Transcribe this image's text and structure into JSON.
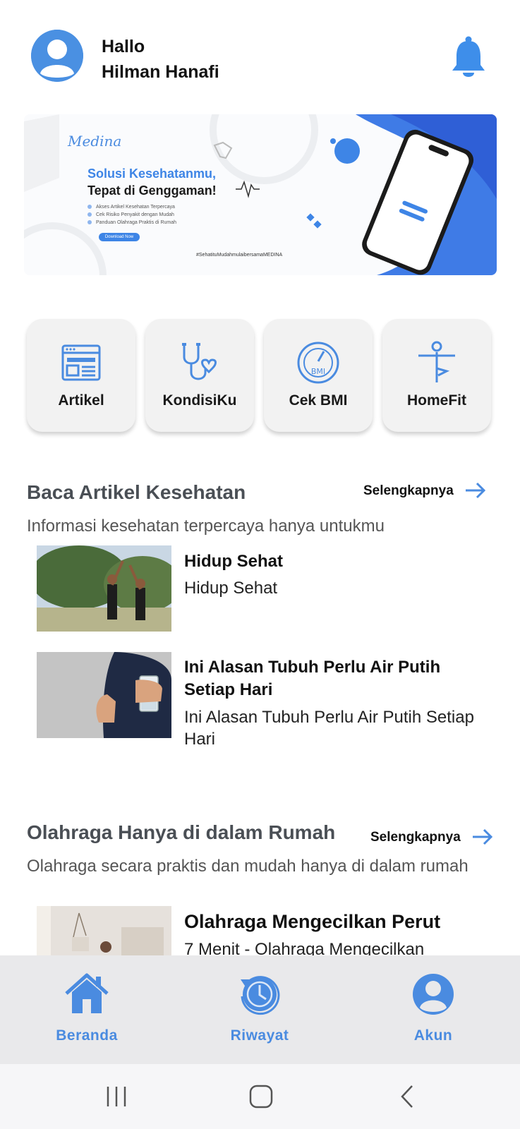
{
  "header": {
    "greeting": "Hallo",
    "user_name": "Hilman Hanafi",
    "avatar_icon": "user-avatar-icon",
    "notification_icon": "bell-icon"
  },
  "banner": {
    "logo_text": "Medina",
    "headline_1": "Solusi Kesehatanmu,",
    "headline_2": "Tepat di Genggaman!",
    "bullets": [
      "Akses Artikel Kesehatan Terpercaya",
      "Cek Risiko Penyakit dengan Mudah",
      "Panduan Olahraga Praktis di Rumah"
    ],
    "button_label": "Download Now",
    "hashtag": "#SehatituMudahmulaibersamaMEDINA"
  },
  "features": [
    {
      "label": "Artikel",
      "icon": "article-icon"
    },
    {
      "label": "KondisiKu",
      "icon": "stethoscope-heart-icon"
    },
    {
      "label": "Cek BMI",
      "icon": "bmi-gauge-icon"
    },
    {
      "label": "HomeFit",
      "icon": "exercise-person-icon"
    }
  ],
  "articles_section": {
    "title": "Baca Artikel Kesehatan",
    "more_label": "Selengkapnya",
    "subtitle": "Informasi kesehatan terpercaya hanya untukmu",
    "items": [
      {
        "title": "Hidup Sehat",
        "subtitle": "Hidup Sehat"
      },
      {
        "title": "Ini Alasan Tubuh Perlu Air Putih Setiap Hari",
        "subtitle": "Ini Alasan Tubuh Perlu Air Putih Setiap Hari"
      }
    ]
  },
  "exercise_section": {
    "title": "Olahraga Hanya di dalam Rumah",
    "more_label": "Selengkapnya",
    "subtitle": "Olahraga secara praktis dan mudah hanya di dalam rumah",
    "items": [
      {
        "title": "Olahraga Mengecilkan Perut",
        "subtitle": "7 Menit - Olahraga Mengecilkan"
      }
    ]
  },
  "bottom_nav": [
    {
      "label": "Beranda",
      "icon": "home-icon"
    },
    {
      "label": "Riwayat",
      "icon": "history-icon"
    },
    {
      "label": "Akun",
      "icon": "account-icon"
    }
  ],
  "colors": {
    "accent": "#4a8be0",
    "nav_background": "#e9e9eb",
    "card_background": "#f2f2f2"
  }
}
